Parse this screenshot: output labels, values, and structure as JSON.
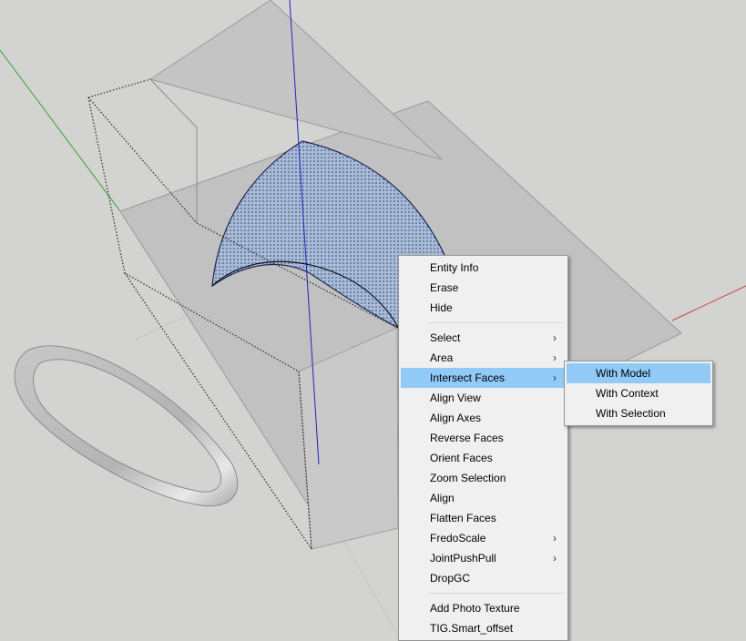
{
  "scene": {
    "background_color": "#d3d3d1",
    "face_color": "#bdbdbd",
    "selected_face_color": "#9fb3cf",
    "axis_colors": {
      "red": "#c6423c",
      "green": "#3aa33a",
      "blue": "#2323b8"
    }
  },
  "context_menu": {
    "sections": [
      [
        {
          "label": "Entity Info",
          "submenu": false
        },
        {
          "label": "Erase",
          "submenu": false
        },
        {
          "label": "Hide",
          "submenu": false
        }
      ],
      [
        {
          "label": "Select",
          "submenu": true
        },
        {
          "label": "Area",
          "submenu": true
        },
        {
          "label": "Intersect Faces",
          "submenu": true,
          "highlighted": true
        },
        {
          "label": "Align View",
          "submenu": false
        },
        {
          "label": "Align Axes",
          "submenu": false
        },
        {
          "label": "Reverse Faces",
          "submenu": false
        },
        {
          "label": "Orient Faces",
          "submenu": false
        },
        {
          "label": "Zoom Selection",
          "submenu": false
        },
        {
          "label": "Align",
          "submenu": false
        },
        {
          "label": "Flatten Faces",
          "submenu": false
        },
        {
          "label": "FredoScale",
          "submenu": true
        },
        {
          "label": "JointPushPull",
          "submenu": true
        },
        {
          "label": "DropGC",
          "submenu": false
        }
      ],
      [
        {
          "label": "Add Photo Texture",
          "submenu": false
        },
        {
          "label": "TIG.Smart_offset",
          "submenu": false
        }
      ]
    ],
    "highlight_color": "#91c9f7"
  },
  "intersect_submenu": {
    "items": [
      {
        "label": "With Model",
        "highlighted": true
      },
      {
        "label": "With Context",
        "highlighted": false
      },
      {
        "label": "With Selection",
        "highlighted": false
      }
    ]
  },
  "icons": {
    "submenu_arrow": "chevron-right-icon"
  }
}
